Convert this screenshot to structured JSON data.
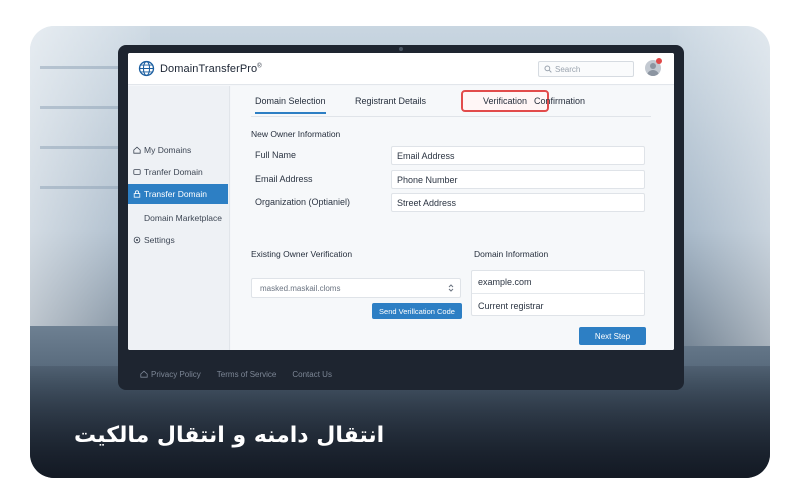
{
  "app": {
    "brand": "DomainTransferPro",
    "brand_mark": "®"
  },
  "header": {
    "search_placeholder": "Search"
  },
  "sidebar": {
    "items": [
      {
        "label": "My Domains",
        "icon": "home-icon"
      },
      {
        "label": "Tranfer Domain",
        "icon": "transfer-icon"
      },
      {
        "label": "Transfer Domain",
        "icon": "lock-icon",
        "active": true
      },
      {
        "label": "Domain Marketplace",
        "icon": ""
      },
      {
        "label": "Settings",
        "icon": "gear-icon"
      }
    ]
  },
  "tabs": [
    {
      "label": "Domain Selection",
      "active": true
    },
    {
      "label": "Registrant Details"
    },
    {
      "label": "Verification",
      "highlighted": true
    },
    {
      "label": "Confirmation"
    }
  ],
  "form": {
    "section_title": "New Owner Information",
    "rows": [
      {
        "label": "Full Name",
        "value": "Email Address"
      },
      {
        "label": "Email Address",
        "value": "Phone Number"
      },
      {
        "label": "Organization (Optianiel)",
        "value": "Street Address"
      }
    ]
  },
  "verification": {
    "title": "Existing Owner Verification",
    "select_value": "masked.maskail.cloms",
    "send_button": "Send Verillcation Code"
  },
  "domain_info": {
    "title": "Domain Information",
    "domain": "example.com",
    "registrar": "Current registrar"
  },
  "actions": {
    "next_step": "Next Step"
  },
  "footer": {
    "links": [
      "Privacy Policy",
      "Terms of Service",
      "Contact Us"
    ]
  },
  "caption": "انتقال دامنه و انتقال مالکیت",
  "colors": {
    "accent": "#2d7fc4",
    "highlight": "#e24b4b",
    "caption_text": "#ffffff"
  }
}
